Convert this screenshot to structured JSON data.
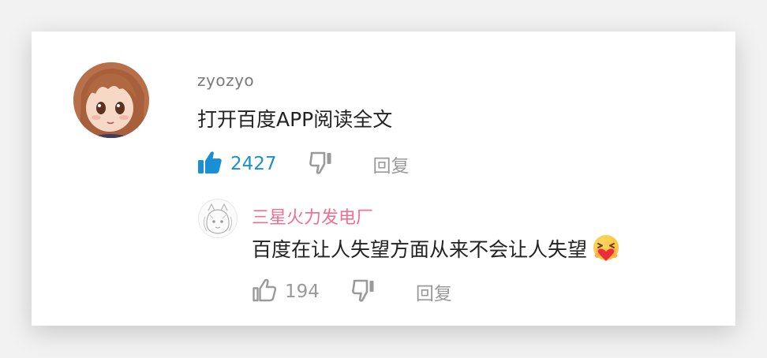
{
  "comment": {
    "username": "zyozyo",
    "text": "打开百度APP阅读全文",
    "like_count": "2427",
    "reply_label": "回复",
    "liked": true
  },
  "reply": {
    "username": "三星火力发电厂",
    "text": "百度在让人失望方面从来不会让人失望",
    "like_count": "194",
    "reply_label": "回复",
    "liked": false,
    "emoji": "hugging-heart-emoji"
  },
  "colors": {
    "liked_blue": "#1a8fd6",
    "neutral_gray": "#9a9a9a",
    "reply_username_pink": "#f0708f",
    "text_dark": "#222222",
    "username_gray": "#7a7a7a"
  },
  "icons": [
    "thumbs-up-filled-icon",
    "thumbs-down-icon",
    "thumbs-up-outline-icon"
  ]
}
